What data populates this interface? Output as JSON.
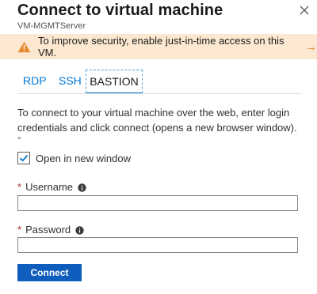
{
  "dialog": {
    "title": "Connect to virtual machine",
    "subtitle": "VM-MGMTServer"
  },
  "banner": {
    "text": "To improve security, enable just-in-time access on this VM.",
    "arrow": "→",
    "icon": "warning-icon",
    "color": "#fce8d0",
    "accent": "#e8882e"
  },
  "tabs": [
    {
      "label": "RDP",
      "active": false
    },
    {
      "label": "SSH",
      "active": false
    },
    {
      "label": "BASTION",
      "active": true
    }
  ],
  "description": "To connect to your virtual machine over the web, enter login credentials and click connect (opens a new browser window).",
  "bullet": "°",
  "open_new_window": {
    "label": "Open in new window",
    "checked": true
  },
  "username": {
    "label": "Username",
    "required_mark": "*",
    "value": ""
  },
  "password": {
    "label": "Password",
    "required_mark": "*",
    "value": ""
  },
  "connect_button": {
    "label": "Connect",
    "color": "#0f5dbd"
  }
}
